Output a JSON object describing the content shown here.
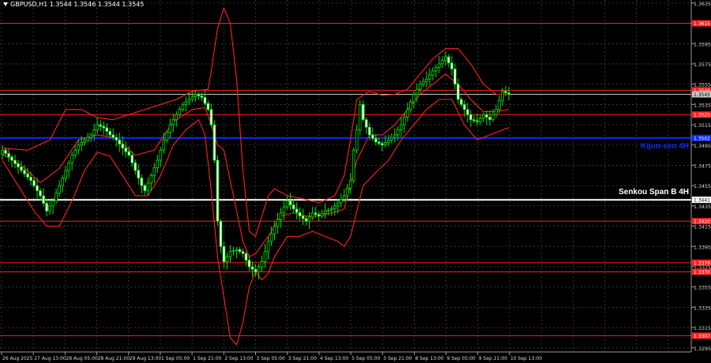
{
  "header": {
    "symbol_info": "GBPUSD,H1  1.3544 1.3546 1.3544 1.3545"
  },
  "chart_data": {
    "type": "candlestick",
    "symbol": "GBPUSD",
    "timeframe": "H1",
    "ohlc_current": [
      1.3544,
      1.3546,
      1.3544,
      1.3545
    ],
    "y_ticks": [
      "1.3635",
      "1.3615",
      "1.3595",
      "1.3575",
      "1.3555",
      "1.3535",
      "1.3515",
      "1.3495",
      "1.3475",
      "1.3455",
      "1.3435",
      "1.3415",
      "1.3395",
      "1.3375",
      "1.3355",
      "1.3335",
      "1.3315",
      "1.3295"
    ],
    "ylim": [
      1.3291,
      1.3638
    ],
    "x_ticks": [
      "26 Aug 2025",
      "27 Aug 13:00",
      "28 Aug 05:00",
      "28 Aug 21:00",
      "29 Aug 13:00",
      "1 Sep 05:00",
      "1 Sep 21:00",
      "2 Sep 13:00",
      "3 Sep 05:00",
      "3 Sep 21:00",
      "4 Sep 13:00",
      "5 Sep 05:00",
      "5 Sep 21:00",
      "8 Sep 13:00",
      "9 Sep 05:00",
      "9 Sep 21:00",
      "10 Sep 13:00"
    ],
    "horizontal_levels": [
      {
        "value": 1.3615,
        "label": "1.3615",
        "color": "#ff2020"
      },
      {
        "value": 1.3549,
        "label": "1.3549",
        "color": "#ff2020"
      },
      {
        "value": 1.3545,
        "label": "1.3545",
        "color": "#c8c8c8"
      },
      {
        "value": 1.3525,
        "label": "1.3525",
        "color": "#ff2020"
      },
      {
        "value": 1.3502,
        "label": "1.3502",
        "color": "#0b2cff",
        "name": "Kijun-sen 4H"
      },
      {
        "value": 1.3441,
        "label": "1.3441",
        "color": "#ffffff",
        "name": "Senkou Span B 4H"
      },
      {
        "value": 1.342,
        "label": "1.3420",
        "color": "#ff2020"
      },
      {
        "value": 1.3379,
        "label": "1.3379",
        "color": "#ff2020"
      },
      {
        "value": 1.337,
        "label": "1.3370",
        "color": "#ff2020"
      },
      {
        "value": 1.3307,
        "label": "1.3307",
        "color": "#ff2020"
      }
    ],
    "price_path": [
      [
        0,
        1.349
      ],
      [
        3,
        1.348
      ],
      [
        6,
        1.347
      ],
      [
        9,
        1.346
      ],
      [
        12,
        1.3445
      ],
      [
        14,
        1.343
      ],
      [
        16,
        1.344
      ],
      [
        18,
        1.3455
      ],
      [
        20,
        1.347
      ],
      [
        22,
        1.3485
      ],
      [
        24,
        1.3495
      ],
      [
        26,
        1.35
      ],
      [
        28,
        1.3505
      ],
      [
        30,
        1.3515
      ],
      [
        32,
        1.3512
      ],
      [
        34,
        1.3505
      ],
      [
        36,
        1.35
      ],
      [
        38,
        1.3492
      ],
      [
        40,
        1.3485
      ],
      [
        42,
        1.347
      ],
      [
        44,
        1.3455
      ],
      [
        45,
        1.345
      ],
      [
        47,
        1.3465
      ],
      [
        49,
        1.348
      ],
      [
        51,
        1.35
      ],
      [
        53,
        1.3515
      ],
      [
        55,
        1.3525
      ],
      [
        57,
        1.3535
      ],
      [
        59,
        1.354
      ],
      [
        61,
        1.3545
      ],
      [
        63,
        1.3542
      ],
      [
        65,
        1.353
      ],
      [
        66,
        1.3515
      ],
      [
        67,
        1.348
      ],
      [
        68,
        1.342
      ],
      [
        69,
        1.3395
      ],
      [
        70,
        1.338
      ],
      [
        72,
        1.339
      ],
      [
        74,
        1.3392
      ],
      [
        76,
        1.3388
      ],
      [
        78,
        1.3375
      ],
      [
        80,
        1.337
      ],
      [
        82,
        1.338
      ],
      [
        84,
        1.34
      ],
      [
        86,
        1.3415
      ],
      [
        88,
        1.3428
      ],
      [
        90,
        1.344
      ],
      [
        92,
        1.3432
      ],
      [
        94,
        1.3425
      ],
      [
        96,
        1.342
      ],
      [
        98,
        1.3428
      ],
      [
        100,
        1.3425
      ],
      [
        102,
        1.343
      ],
      [
        104,
        1.3432
      ],
      [
        106,
        1.3438
      ],
      [
        108,
        1.3445
      ],
      [
        110,
        1.346
      ],
      [
        111,
        1.349
      ],
      [
        112,
        1.351
      ],
      [
        113,
        1.3535
      ],
      [
        114,
        1.352
      ],
      [
        116,
        1.3505
      ],
      [
        118,
        1.3498
      ],
      [
        120,
        1.3495
      ],
      [
        122,
        1.35
      ],
      [
        124,
        1.3505
      ],
      [
        126,
        1.3515
      ],
      [
        128,
        1.353
      ],
      [
        130,
        1.3545
      ],
      [
        132,
        1.3555
      ],
      [
        134,
        1.356
      ],
      [
        136,
        1.3568
      ],
      [
        138,
        1.3575
      ],
      [
        140,
        1.3582
      ],
      [
        142,
        1.357
      ],
      [
        143,
        1.3555
      ],
      [
        144,
        1.354
      ],
      [
        146,
        1.353
      ],
      [
        148,
        1.352
      ],
      [
        150,
        1.3518
      ],
      [
        152,
        1.3525
      ],
      [
        154,
        1.352
      ],
      [
        156,
        1.353
      ],
      [
        158,
        1.3548
      ],
      [
        160,
        1.3545
      ]
    ],
    "bollinger_upper": [
      [
        0,
        1.3492
      ],
      [
        8,
        1.349
      ],
      [
        15,
        1.35
      ],
      [
        20,
        1.353
      ],
      [
        25,
        1.353
      ],
      [
        30,
        1.3522
      ],
      [
        35,
        1.352
      ],
      [
        40,
        1.3525
      ],
      [
        45,
        1.353
      ],
      [
        50,
        1.3535
      ],
      [
        55,
        1.354
      ],
      [
        60,
        1.3548
      ],
      [
        65,
        1.355
      ],
      [
        66,
        1.3568
      ],
      [
        68,
        1.361
      ],
      [
        70,
        1.363
      ],
      [
        72,
        1.3615
      ],
      [
        74,
        1.356
      ],
      [
        76,
        1.347
      ],
      [
        78,
        1.341
      ],
      [
        80,
        1.3405
      ],
      [
        82,
        1.3425
      ],
      [
        84,
        1.3445
      ],
      [
        86,
        1.3452
      ],
      [
        90,
        1.3445
      ],
      [
        95,
        1.3442
      ],
      [
        100,
        1.3438
      ],
      [
        105,
        1.3445
      ],
      [
        108,
        1.3465
      ],
      [
        110,
        1.35
      ],
      [
        112,
        1.354
      ],
      [
        116,
        1.3548
      ],
      [
        120,
        1.3544
      ],
      [
        124,
        1.3545
      ],
      [
        128,
        1.355
      ],
      [
        132,
        1.3565
      ],
      [
        136,
        1.358
      ],
      [
        140,
        1.359
      ],
      [
        144,
        1.359
      ],
      [
        148,
        1.3575
      ],
      [
        152,
        1.3555
      ],
      [
        156,
        1.3545
      ],
      [
        160,
        1.3545
      ]
    ],
    "bollinger_lower": [
      [
        0,
        1.348
      ],
      [
        6,
        1.345
      ],
      [
        10,
        1.343
      ],
      [
        14,
        1.3415
      ],
      [
        18,
        1.3415
      ],
      [
        22,
        1.344
      ],
      [
        26,
        1.347
      ],
      [
        30,
        1.3488
      ],
      [
        34,
        1.3484
      ],
      [
        38,
        1.3465
      ],
      [
        42,
        1.3445
      ],
      [
        46,
        1.3445
      ],
      [
        50,
        1.3465
      ],
      [
        54,
        1.3495
      ],
      [
        58,
        1.351
      ],
      [
        62,
        1.352
      ],
      [
        64,
        1.3505
      ],
      [
        66,
        1.345
      ],
      [
        68,
        1.3385
      ],
      [
        70,
        1.3345
      ],
      [
        72,
        1.3305
      ],
      [
        74,
        1.3298
      ],
      [
        76,
        1.332
      ],
      [
        78,
        1.3355
      ],
      [
        80,
        1.337
      ],
      [
        82,
        1.3362
      ],
      [
        84,
        1.3368
      ],
      [
        86,
        1.3385
      ],
      [
        90,
        1.3405
      ],
      [
        94,
        1.3405
      ],
      [
        98,
        1.341
      ],
      [
        102,
        1.3405
      ],
      [
        106,
        1.34
      ],
      [
        108,
        1.3395
      ],
      [
        110,
        1.3405
      ],
      [
        112,
        1.343
      ],
      [
        114,
        1.3455
      ],
      [
        118,
        1.3468
      ],
      [
        122,
        1.348
      ],
      [
        126,
        1.35
      ],
      [
        130,
        1.3515
      ],
      [
        134,
        1.353
      ],
      [
        138,
        1.354
      ],
      [
        142,
        1.354
      ],
      [
        146,
        1.3515
      ],
      [
        150,
        1.35
      ],
      [
        154,
        1.3505
      ],
      [
        158,
        1.351
      ],
      [
        160,
        1.3512
      ]
    ],
    "bollinger_middle": [
      [
        0,
        1.3486
      ],
      [
        6,
        1.3475
      ],
      [
        12,
        1.3458
      ],
      [
        18,
        1.3472
      ],
      [
        24,
        1.35
      ],
      [
        30,
        1.3505
      ],
      [
        36,
        1.3502
      ],
      [
        42,
        1.3485
      ],
      [
        48,
        1.349
      ],
      [
        54,
        1.3518
      ],
      [
        60,
        1.353
      ],
      [
        64,
        1.3532
      ],
      [
        66,
        1.3515
      ],
      [
        68,
        1.3495
      ],
      [
        70,
        1.349
      ],
      [
        72,
        1.346
      ],
      [
        74,
        1.343
      ],
      [
        76,
        1.34
      ],
      [
        78,
        1.3385
      ],
      [
        80,
        1.3388
      ],
      [
        84,
        1.3405
      ],
      [
        88,
        1.3425
      ],
      [
        92,
        1.3428
      ],
      [
        96,
        1.3425
      ],
      [
        100,
        1.3425
      ],
      [
        104,
        1.3428
      ],
      [
        108,
        1.3432
      ],
      [
        112,
        1.348
      ],
      [
        116,
        1.3505
      ],
      [
        120,
        1.3505
      ],
      [
        124,
        1.3515
      ],
      [
        128,
        1.353
      ],
      [
        132,
        1.3545
      ],
      [
        136,
        1.3555
      ],
      [
        140,
        1.3565
      ],
      [
        144,
        1.3555
      ],
      [
        148,
        1.354
      ],
      [
        152,
        1.3528
      ],
      [
        156,
        1.3528
      ],
      [
        160,
        1.353
      ]
    ]
  }
}
